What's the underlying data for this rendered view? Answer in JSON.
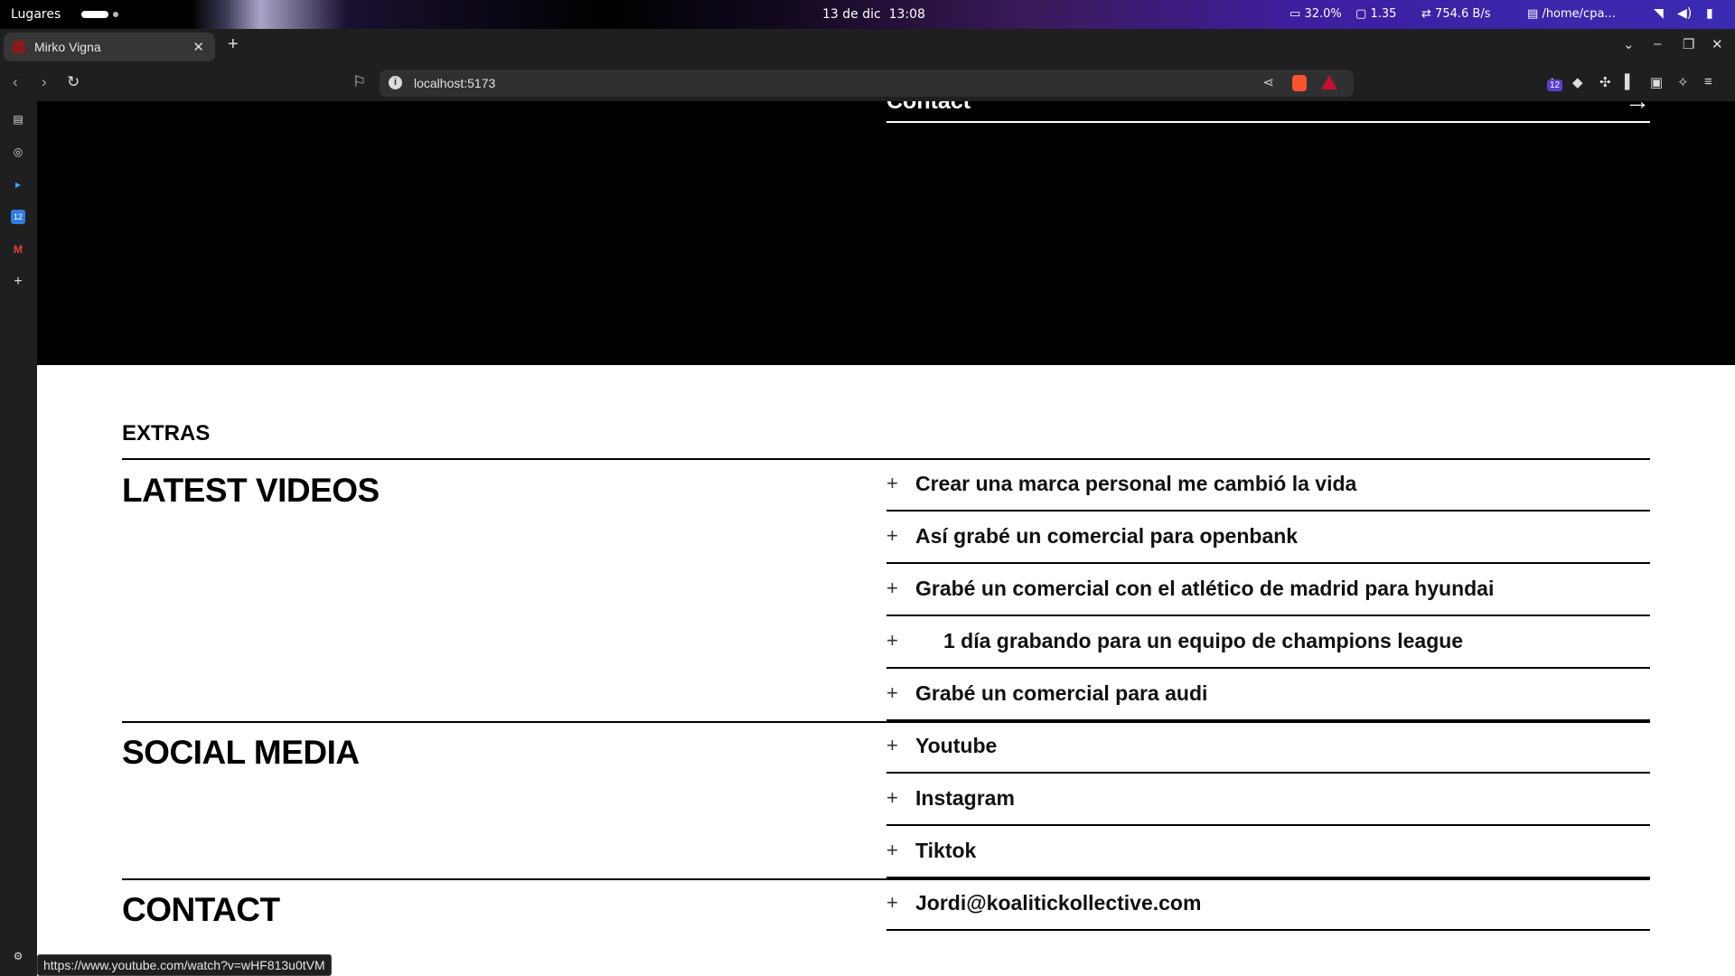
{
  "system": {
    "places": "Lugares",
    "date": "13 de dic",
    "time": "13:08",
    "cpu": "32.0%",
    "load": "1.35",
    "net": "754.6 B/s",
    "path": "/home/cpa..."
  },
  "browser": {
    "tab_title": "Mirko Vigna",
    "url": "localhost:5173",
    "ext_badge": "12",
    "sidebar_calendar": "12"
  },
  "hero": {
    "contact_label": "Contact"
  },
  "page": {
    "extras_label": "EXTRAS",
    "sections": {
      "videos_title": "LATEST VIDEOS",
      "social_title": "SOCIAL MEDIA",
      "contact_title": "CONTACT"
    },
    "videos": [
      "Crear una marca personal me cambió la vida",
      "Así grabé un comercial para openbank",
      "Grabé un comercial con el atlético de madrid para hyundai",
      "1 día grabando para un equipo de champions league",
      "Grabé un comercial para audi"
    ],
    "social": [
      "Youtube",
      "Instagram",
      "Tiktok"
    ],
    "contact": [
      "Jordi@koalitickollective.com"
    ]
  },
  "status_url": "https://www.youtube.com/watch?v=wHF813u0tVM"
}
